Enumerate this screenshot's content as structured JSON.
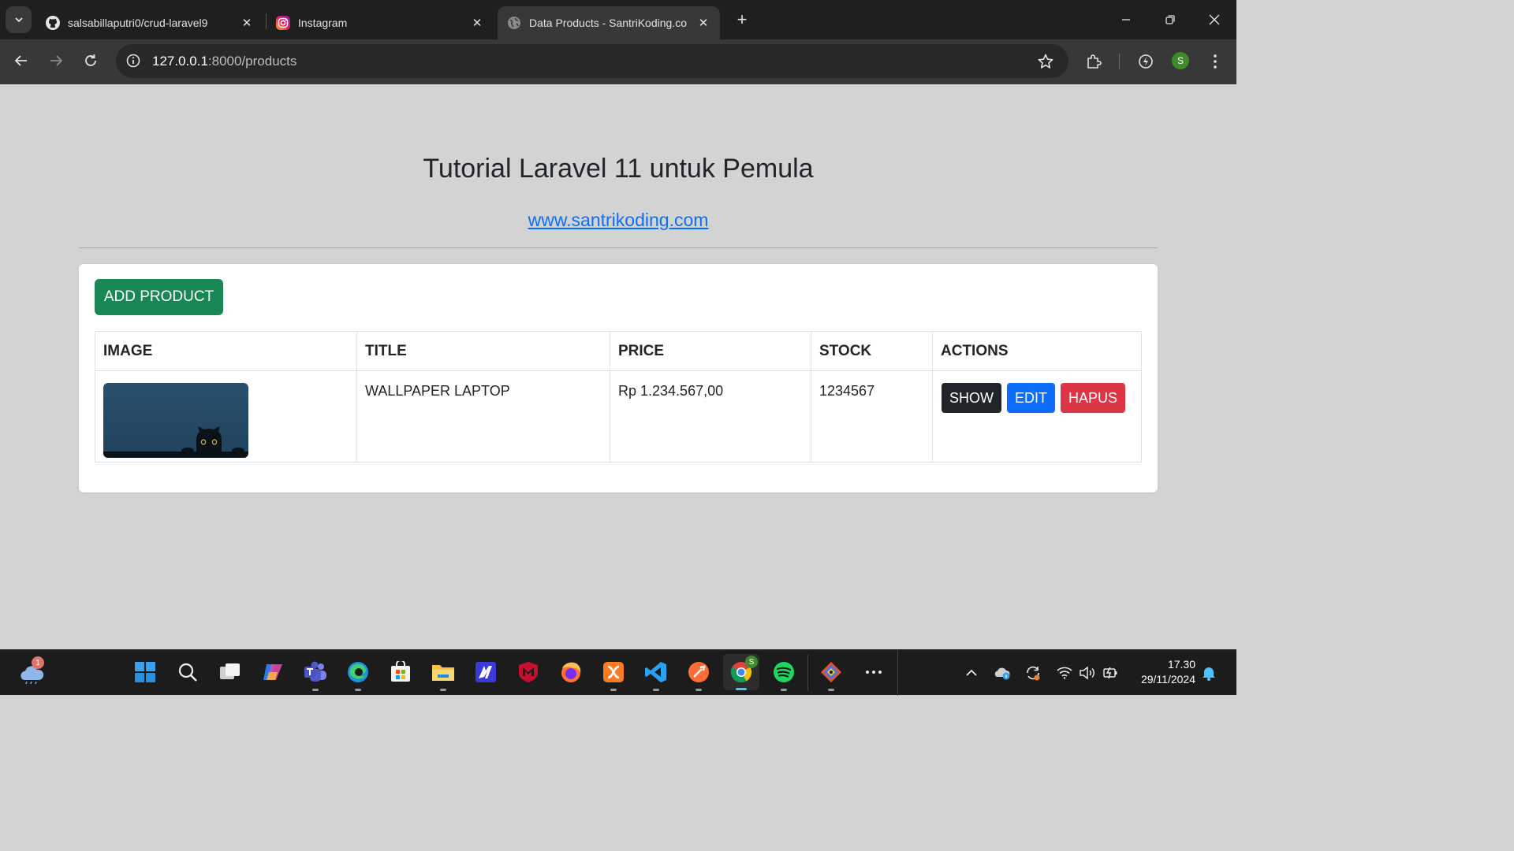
{
  "browser": {
    "tabs": [
      {
        "title": "salsabillaputri0/crud-laravel9",
        "icon": "github-icon",
        "active": false
      },
      {
        "title": "Instagram",
        "icon": "instagram-icon",
        "active": false
      },
      {
        "title": "Data Products - SantriKoding.co",
        "icon": "globe-icon",
        "active": true
      }
    ],
    "url_host": "127.0.0.1",
    "url_path": ":8000/products",
    "profile_initial": "S",
    "colors": {
      "frame": "#1f1f1f",
      "toolbar": "#383838",
      "omnibox": "#282828"
    }
  },
  "page": {
    "title": "Tutorial Laravel 11 untuk Pemula",
    "link": "www.santrikoding.com",
    "add_button": "ADD PRODUCT",
    "columns": [
      "IMAGE",
      "TITLE",
      "PRICE",
      "STOCK",
      "ACTIONS"
    ],
    "rows": [
      {
        "image": "black cat peeking over ledge on dark blue background",
        "title": "WALLPAPER LAPTOP",
        "price": "Rp 1.234.567,00",
        "stock": "1234567",
        "actions": {
          "show": "SHOW",
          "edit": "EDIT",
          "delete": "HAPUS"
        }
      }
    ],
    "colors": {
      "background": "#d3d3d3",
      "success": "#198754",
      "primary": "#0d6efd",
      "danger": "#dc3545",
      "dark": "#212529"
    }
  },
  "taskbar": {
    "weather_badge": "1",
    "apps": [
      "start-icon",
      "search-icon",
      "task-view-icon",
      "copilot-icon",
      "teams-icon",
      "edge-icon",
      "store-icon",
      "file-explorer-icon",
      "app-icon",
      "mcafee-icon",
      "firefox-icon",
      "xampp-icon",
      "vscode-icon",
      "postman-icon",
      "chrome-icon",
      "spotify-icon",
      "git-icon",
      "more-icon"
    ],
    "chrome_badge": "S",
    "time": "17.30",
    "date": "29/11/2024"
  }
}
